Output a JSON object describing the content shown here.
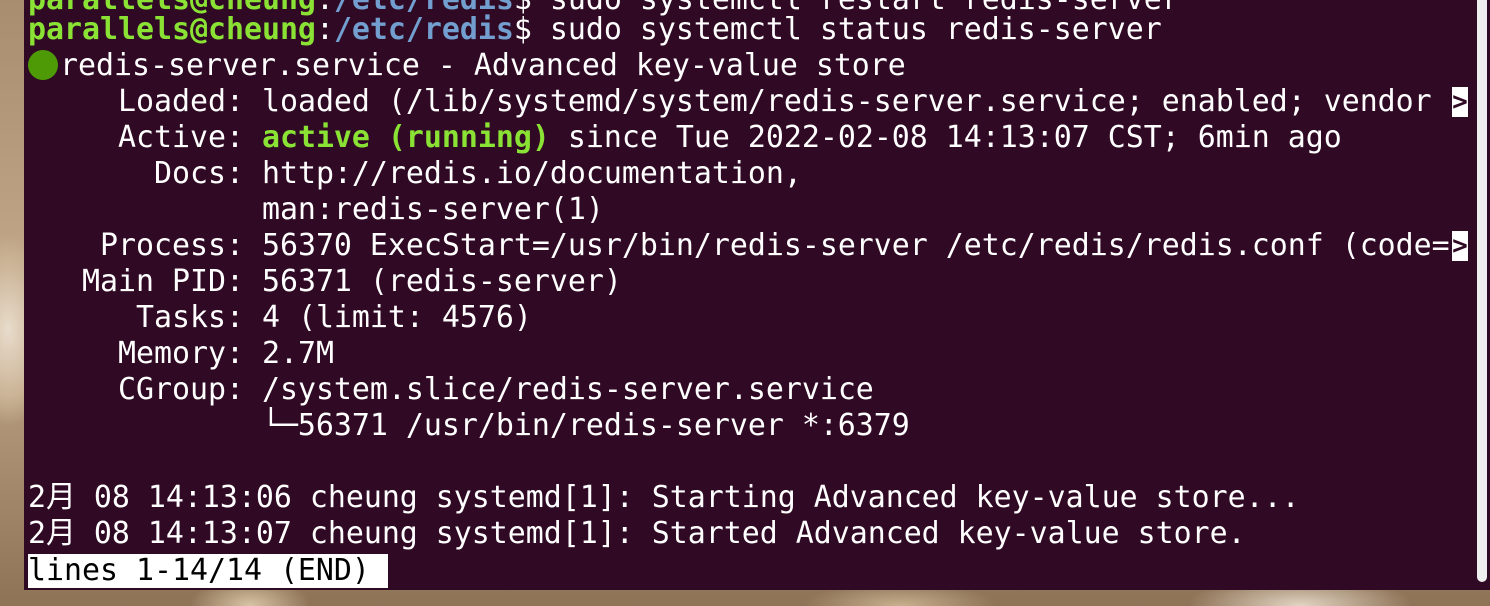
{
  "terminal": {
    "prev_command_partial": {
      "user_host": "parallels@cheung",
      "colon": ":",
      "path": "/etc/redis",
      "prompt": "$",
      "command": " sudo systemctl restart redis-server"
    },
    "command_line": {
      "user_host": "parallels@cheung",
      "colon": ":",
      "path": "/etc/redis",
      "prompt": "$",
      "command": " sudo systemctl status redis-server"
    },
    "service_header": "redis-server.service - Advanced key-value store",
    "loaded": {
      "label": "     Loaded: ",
      "value": "loaded (/lib/systemd/system/redis-server.service; enabled; vendor "
    },
    "active": {
      "label": "     Active: ",
      "state": "active (running)",
      "rest": " since Tue 2022-02-08 14:13:07 CST; 6min ago"
    },
    "docs": {
      "label": "       Docs: ",
      "value1": "http://redis.io/documentation,",
      "value2": "             man:redis-server(1)"
    },
    "process": {
      "label": "    Process: ",
      "value": "56370 ExecStart=/usr/bin/redis-server /etc/redis/redis.conf (code="
    },
    "main_pid": {
      "label": "   Main PID: ",
      "value": "56371 (redis-server)"
    },
    "tasks": {
      "label": "      Tasks: ",
      "value": "4 (limit: 4576)"
    },
    "memory": {
      "label": "     Memory: ",
      "value": "2.7M"
    },
    "cgroup": {
      "label": "     CGroup: ",
      "value": "/system.slice/redis-server.service",
      "child": "             └─56371 /usr/bin/redis-server *:6379"
    },
    "journal": [
      "2月 08 14:13:06 cheung systemd[1]: Starting Advanced key-value store...",
      "2月 08 14:13:07 cheung systemd[1]: Started Advanced key-value store."
    ],
    "truncation_marker": ">",
    "pager_status": "lines 1-14/14 (END)"
  },
  "colors": {
    "background": "#300a24",
    "prompt_user": "#8ae234",
    "prompt_path": "#729fcf",
    "active_state": "#8ae234",
    "status_dot": "#4e9a06"
  }
}
